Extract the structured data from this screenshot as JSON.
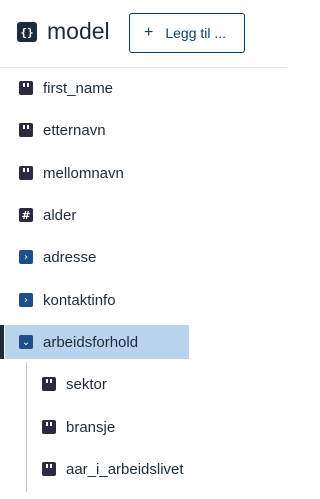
{
  "header": {
    "title": "model",
    "title_icon": "curly-braces-icon",
    "add_button_label": "Legg til ..."
  },
  "tree": {
    "items": [
      {
        "label": "first_name",
        "icon": "field-icon",
        "selected": false
      },
      {
        "label": "etternavn",
        "icon": "field-icon",
        "selected": false
      },
      {
        "label": "mellomnavn",
        "icon": "field-icon",
        "selected": false
      },
      {
        "label": "alder",
        "icon": "number-icon",
        "selected": false
      },
      {
        "label": "adresse",
        "icon": "chevron-right-icon",
        "selected": false
      },
      {
        "label": "kontaktinfo",
        "icon": "chevron-right-icon",
        "selected": false
      },
      {
        "label": "arbeidsforhold",
        "icon": "chevron-down-icon",
        "selected": true,
        "children": [
          {
            "label": "sektor",
            "icon": "field-icon"
          },
          {
            "label": "bransje",
            "icon": "field-icon"
          },
          {
            "label": "aar_i_arbeidslivet",
            "icon": "field-icon"
          }
        ]
      }
    ]
  },
  "colors": {
    "text": "#1e2b3c",
    "accent": "#0b3d6b",
    "selected_bg": "#b9d3ec",
    "chevron_icon_bg": "#1e4f8a"
  }
}
